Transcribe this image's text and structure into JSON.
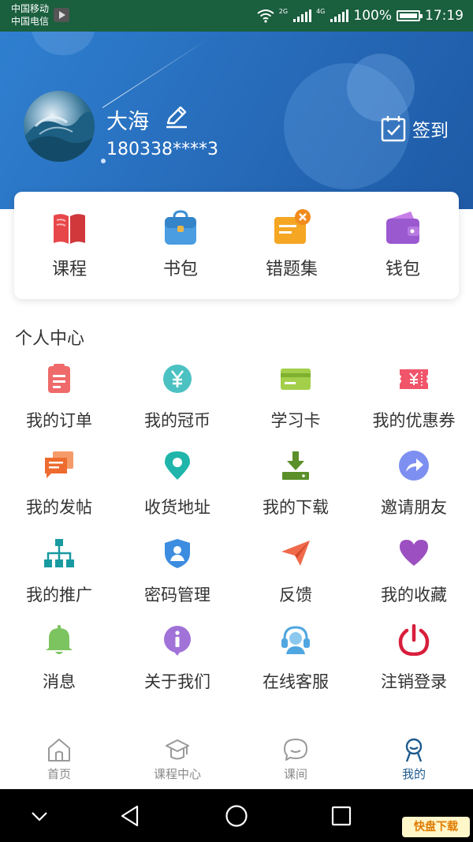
{
  "status_bar": {
    "carrier1": "中国移动",
    "carrier2": "中国电信",
    "sig1_label": "2G",
    "sig2_label": "4G",
    "battery": "100%",
    "time": "17:19"
  },
  "profile": {
    "name": "大海",
    "phone": "180338****3",
    "checkin_label": "签到"
  },
  "quick_actions": [
    {
      "label": "课程",
      "icon": "book-icon"
    },
    {
      "label": "书包",
      "icon": "schoolbag-icon"
    },
    {
      "label": "错题集",
      "icon": "mistakes-icon"
    },
    {
      "label": "钱包",
      "icon": "wallet-icon"
    }
  ],
  "personal_center": {
    "title": "个人中心",
    "items": [
      {
        "label": "我的订单",
        "icon": "order-icon"
      },
      {
        "label": "我的冠币",
        "icon": "coin-icon"
      },
      {
        "label": "学习卡",
        "icon": "card-icon"
      },
      {
        "label": "我的优惠券",
        "icon": "coupon-icon"
      },
      {
        "label": "我的发帖",
        "icon": "posts-icon"
      },
      {
        "label": "收货地址",
        "icon": "location-icon"
      },
      {
        "label": "我的下载",
        "icon": "download-icon"
      },
      {
        "label": "邀请朋友",
        "icon": "share-icon"
      },
      {
        "label": "我的推广",
        "icon": "hierarchy-icon"
      },
      {
        "label": "密码管理",
        "icon": "shield-user-icon"
      },
      {
        "label": "反馈",
        "icon": "paper-plane-icon"
      },
      {
        "label": "我的收藏",
        "icon": "heart-icon"
      },
      {
        "label": "消息",
        "icon": "bell-icon"
      },
      {
        "label": "关于我们",
        "icon": "info-icon"
      },
      {
        "label": "在线客服",
        "icon": "headset-icon"
      },
      {
        "label": "注销登录",
        "icon": "power-icon"
      }
    ]
  },
  "bottom_nav": {
    "items": [
      {
        "label": "首页",
        "icon": "home-icon"
      },
      {
        "label": "课程中心",
        "icon": "graduation-cap-icon"
      },
      {
        "label": "课间",
        "icon": "chat-bubble-icon"
      },
      {
        "label": "我的",
        "icon": "user-icon",
        "active": true
      }
    ]
  },
  "watermark": "快盘下载",
  "colors": {
    "header_blue": "#2568b6",
    "active_nav": "#1d5a8e",
    "status_bar": "#1a5f3e"
  }
}
